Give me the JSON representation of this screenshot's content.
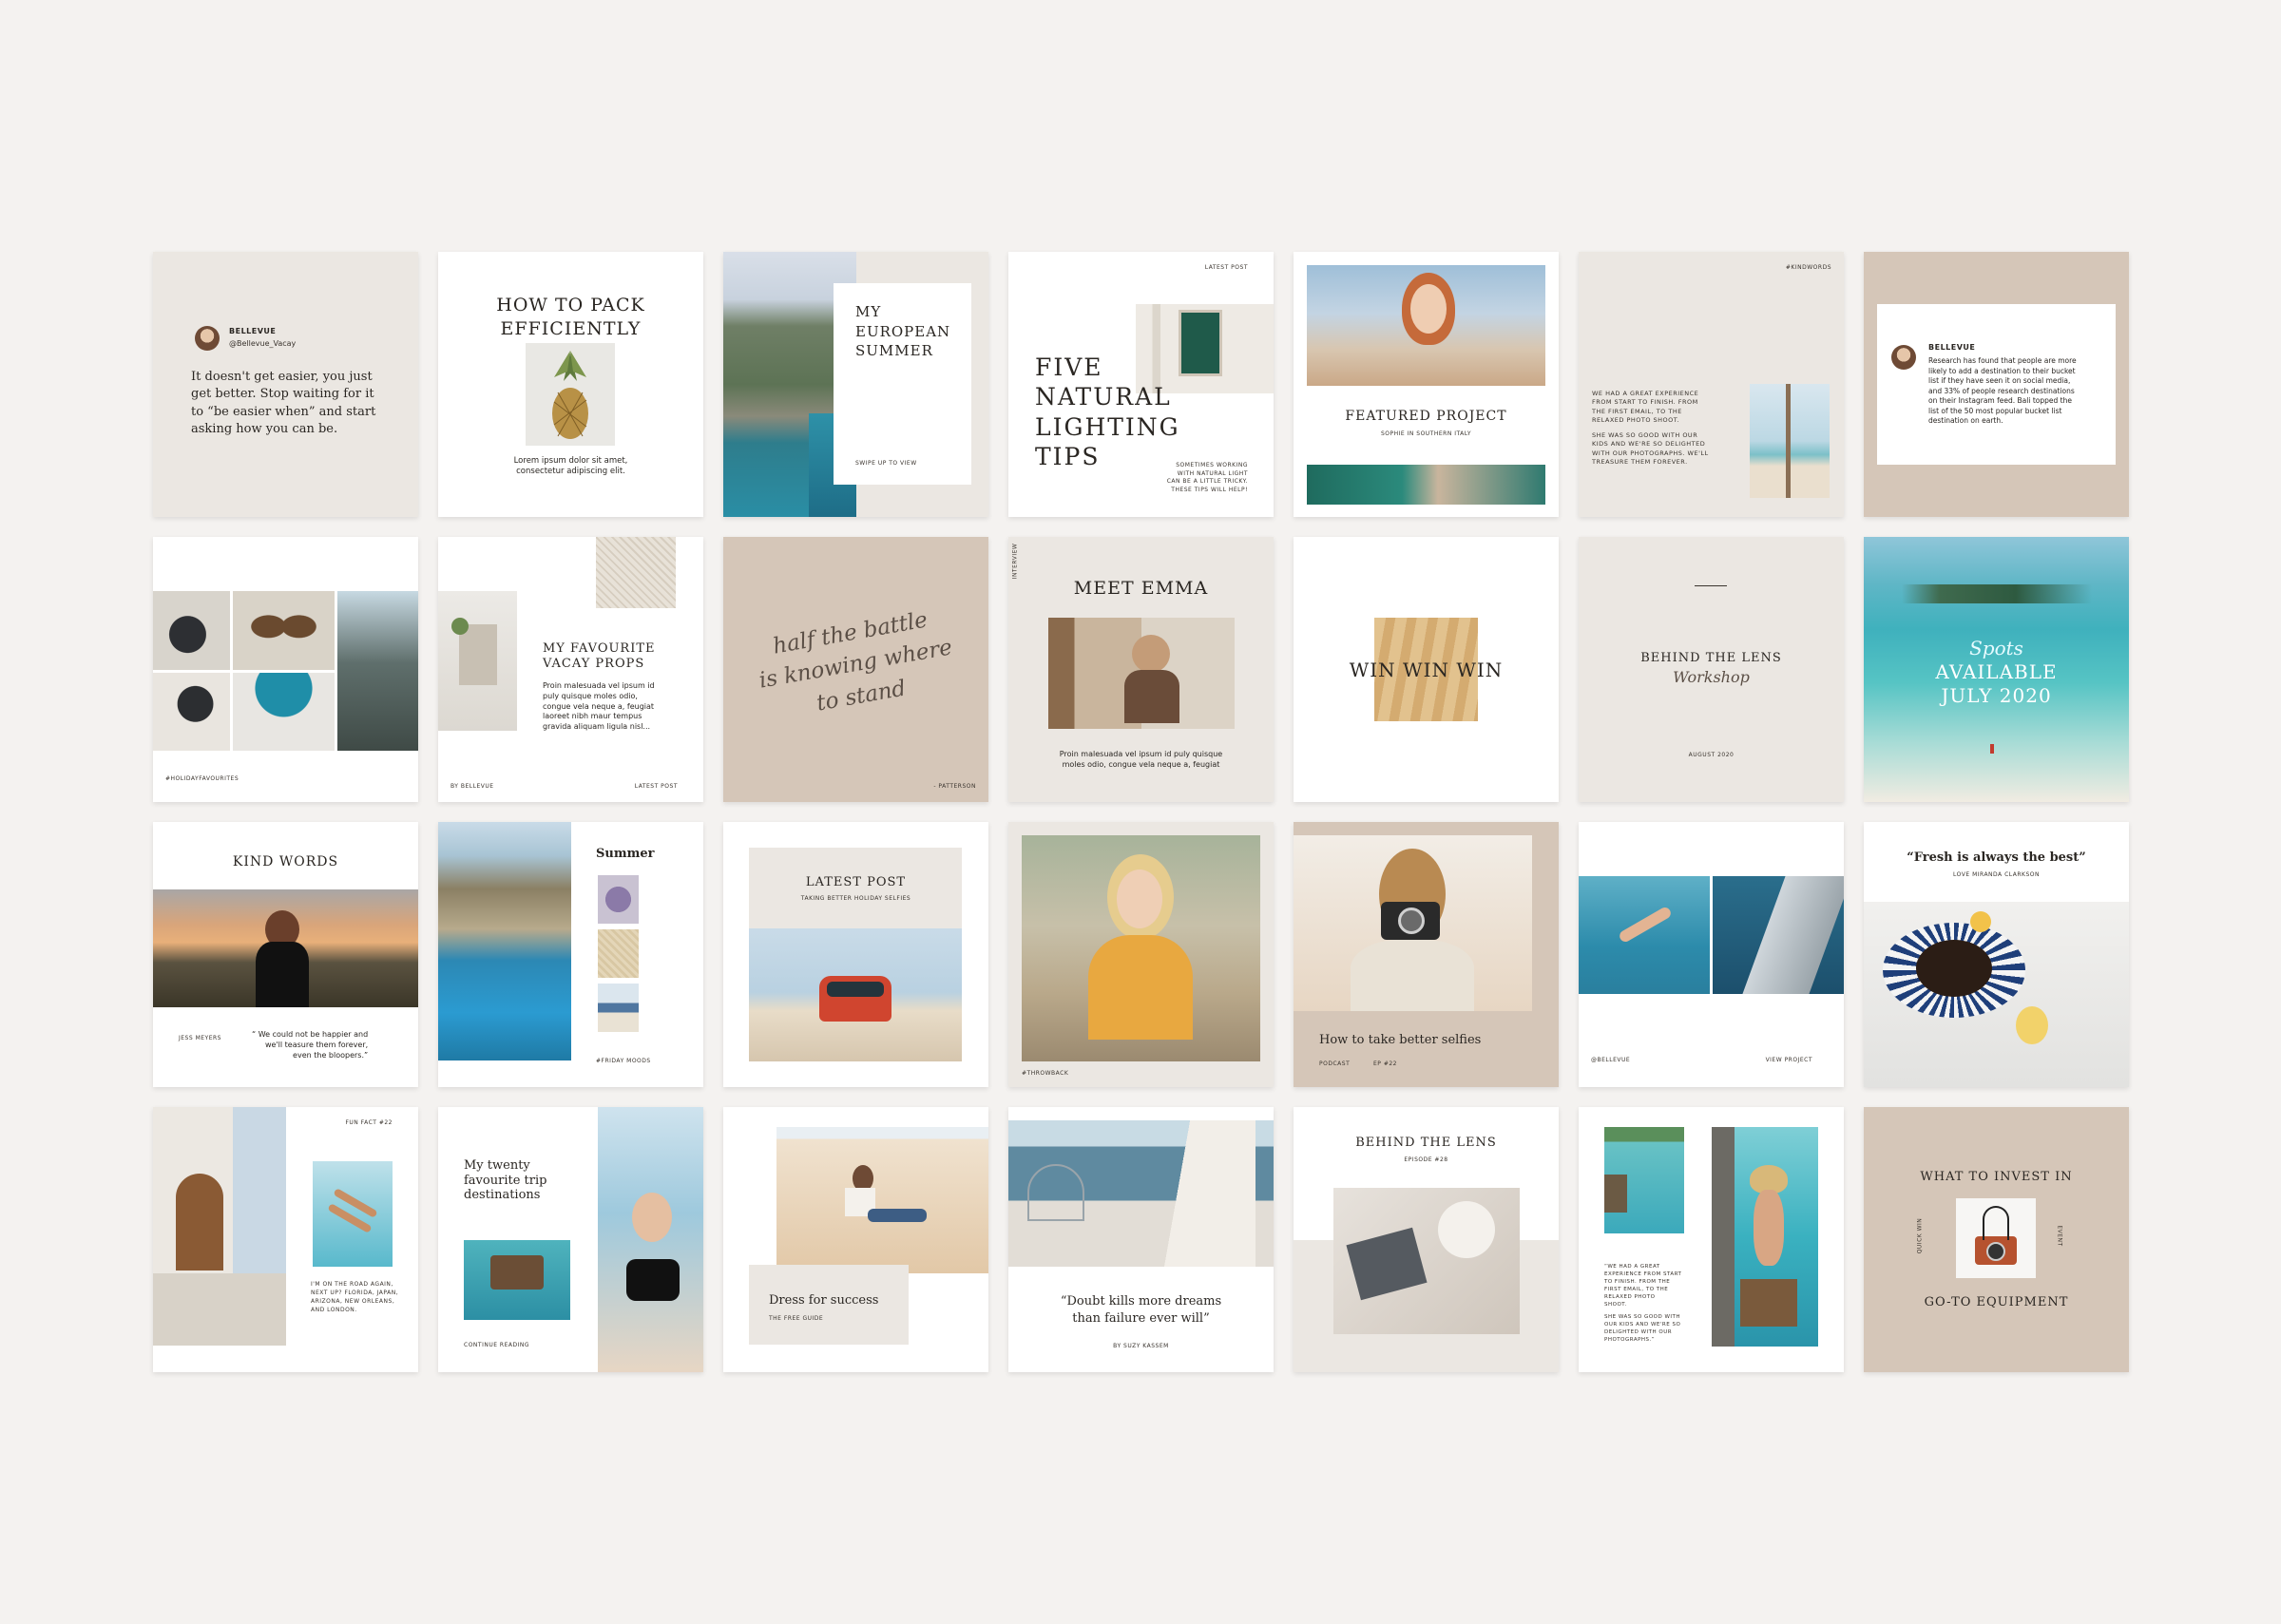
{
  "t1": {
    "name": "BELLEVUE",
    "handle": "@Bellevue_Vacay",
    "quote": "It doesn't get easier, you just get better. Stop waiting for it to “be easier when” and start asking how you can be."
  },
  "t2": {
    "title1": "HOW TO PACK",
    "title2": "EFFICIENTLY",
    "body1": "Lorem ipsum dolor sit amet,",
    "body2": "consectetur adipiscing elit."
  },
  "t3": {
    "title1": "MY",
    "title2": "EUROPEAN",
    "title3": "SUMMER",
    "cta": "SWIPE UP TO VIEW"
  },
  "t4": {
    "tag": "LATEST POST",
    "title1": "FIVE",
    "title2": "NATURAL",
    "title3": "LIGHTING",
    "title4": "TIPS",
    "note1": "SOMETIMES WORKING",
    "note2": "WITH NATURAL LIGHT",
    "note3": "CAN BE A LITTLE TRICKY.",
    "note4": "THESE TIPS WILL HELP!"
  },
  "t5": {
    "title": "FEATURED PROJECT",
    "sub": "SOPHIE IN SOUTHERN ITALY"
  },
  "t6": {
    "tag": "#KINDWORDS",
    "l1": "WE HAD A GREAT EXPERIENCE",
    "l2": "FROM START TO FINISH. FROM",
    "l3": "THE FIRST EMAIL, TO THE",
    "l4": "RELAXED PHOTO SHOOT.",
    "l5": "SHE WAS SO GOOD WITH OUR",
    "l6": "KIDS AND WE'RE SO DELIGHTED",
    "l7": "WITH OUR PHOTOGRAPHS. WE'LL",
    "l8": "TREASURE THEM FOREVER."
  },
  "t7": {
    "name": "BELLEVUE",
    "l1": "Research has found that people are more",
    "l2": "likely to add a destination to their bucket",
    "l3": "list if they have seen it on social media,",
    "l4": "and 33% of people research destinations",
    "l5": "on their Instagram feed. Bali topped the",
    "l6": "list of the 50 most popular bucket list",
    "l7": "destination on earth."
  },
  "t8": {
    "tag": "#HOLIDAYFAVOURITES"
  },
  "t9": {
    "title1": "MY FAVOURITE",
    "title2": "VACAY PROPS",
    "l1": "Proin malesuada vel ipsum id",
    "l2": "puly quisque moles odio,",
    "l3": "congue vela neque a, feugiat",
    "l4": "laoreet nibh maur tempus",
    "l5": "gravida aliquam ligula nisl...",
    "by": "BY BELLEVUE",
    "tag": "LATEST POST"
  },
  "t10": {
    "s1": "half the battle",
    "s2": "is knowing where",
    "s3": "to stand",
    "credit": "- PATTERSON"
  },
  "t11": {
    "side": "INTERVIEW",
    "title": "MEET EMMA",
    "l1": "Proin malesuada vel ipsum id puly quisque",
    "l2": "moles odio, congue vela neque a, feugiat"
  },
  "t12": {
    "title": "WIN WIN WIN"
  },
  "t13": {
    "title": "BEHIND THE LENS",
    "script": "Workshop",
    "date": "AUGUST 2020"
  },
  "t14": {
    "script": "Spots",
    "l1": "AVAILABLE",
    "l2": "JULY 2020"
  },
  "t15": {
    "title": "KIND WORDS",
    "name": "JESS MEYERS",
    "q1": "“ We could not be happier and",
    "q2": "we'll teasure them forever,",
    "q3": "even the bloopers.”"
  },
  "t16": {
    "title": "Summer",
    "tag": "#FRIDAY MOODS"
  },
  "t17": {
    "title": "LATEST POST",
    "sub": "TAKING BETTER HOLIDAY SELFIES"
  },
  "t18": {
    "tag": "#THROWBACK"
  },
  "t19": {
    "title": "How to take better selfies",
    "tag1": "PODCAST",
    "tag2": "EP #22"
  },
  "t20": {
    "handle": "@BELLEVUE",
    "cta": "VIEW PROJECT"
  },
  "t21": {
    "title": "“Fresh is always the best”",
    "sub": "LOVE MIRANDA CLARKSON"
  },
  "t22": {
    "tag": "FUN FACT #22",
    "l1": "I'M ON THE ROAD AGAIN,",
    "l2": "NEXT UP? FLORIDA, JAPAN,",
    "l3": "ARIZONA, NEW ORLEANS,",
    "l4": "AND LONDON."
  },
  "t23": {
    "t1": "My twenty",
    "t2": "favourite trip",
    "t3": "destinations",
    "cta": "CONTINUE READING"
  },
  "t24": {
    "title": "Dress for success",
    "sub": "THE FREE GUIDE"
  },
  "t25": {
    "q1": "“Doubt kills more dreams",
    "q2": "than failure ever will”",
    "by": "BY SUZY KASSEM"
  },
  "t26": {
    "title": "BEHIND THE LENS",
    "sub": "EPISODE #28"
  },
  "t27": {
    "l1": "“WE HAD A GREAT",
    "l2": "EXPERIENCE FROM START",
    "l3": "TO FINISH. FROM THE",
    "l4": "FIRST EMAIL, TO THE",
    "l5": "RELAXED PHOTO",
    "l6": "SHOOT.",
    "l7": "SHE WAS SO GOOD WITH",
    "l8": "OUR KIDS AND WE'RE SO",
    "l9": "DELIGHTED WITH OUR",
    "l10": "PHOTOGRAPHS.”"
  },
  "t28": {
    "title1": "WHAT TO INVEST IN",
    "title2": "GO-TO EQUIPMENT",
    "sideL": "QUICK WIN",
    "sideR": "EVENT"
  },
  "colors": {
    "background": "#f4f2f0",
    "beige": "#ebe7e2",
    "taupe": "#d5c6b8",
    "text": "#2a2622",
    "sea": "#3a9fb8"
  }
}
